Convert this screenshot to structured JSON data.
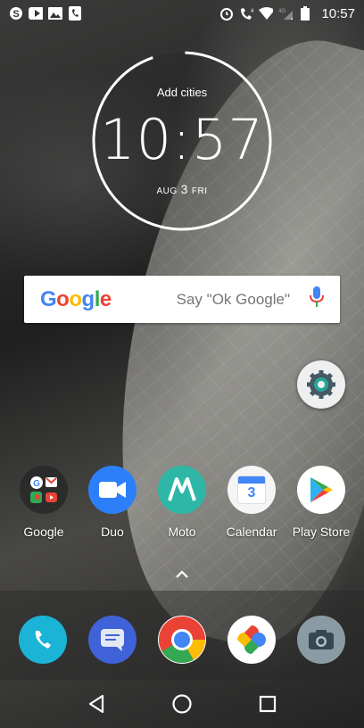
{
  "status_bar": {
    "time": "10:57",
    "left_icons": [
      "skype-icon",
      "youtube-icon",
      "gallery-icon",
      "phone-notification-icon"
    ],
    "right_icons": [
      "alarm-icon",
      "wifi-calling-icon",
      "wifi-icon",
      "signal-icon",
      "battery-icon"
    ],
    "network_labels": [
      "4G",
      "4G"
    ]
  },
  "clock_widget": {
    "add_cities": "Add cities",
    "time": "10:57",
    "month": "AUG",
    "day": "3",
    "weekday": "FRI"
  },
  "search_bar": {
    "logo": "Google",
    "hint": "Say \"Ok Google\""
  },
  "home_apps": [
    {
      "label": "Google"
    },
    {
      "label": "Duo"
    },
    {
      "label": "Moto"
    },
    {
      "label": "Calendar",
      "icon_text": "3"
    },
    {
      "label": "Play Store"
    }
  ],
  "dock_apps": [
    "phone-icon",
    "messages-icon",
    "chrome-icon",
    "photos-icon",
    "camera-icon"
  ],
  "nav": [
    "back-icon",
    "home-icon",
    "recents-icon"
  ],
  "colors": {
    "google_blue": "#4285F4",
    "google_red": "#EA4335",
    "google_yellow": "#FBBC05",
    "google_green": "#34A853",
    "duo_blue": "#2D7FF9",
    "moto_teal": "#2EB7A6",
    "phone_teal": "#1BB3D6",
    "messages_blue": "#4062D8"
  }
}
